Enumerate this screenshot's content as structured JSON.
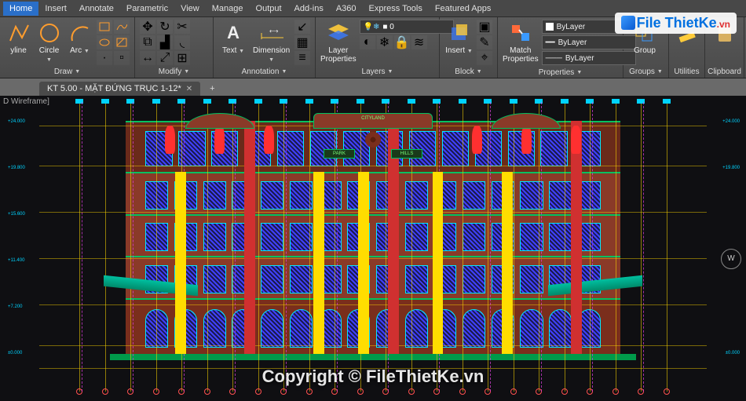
{
  "menu": {
    "items": [
      "Home",
      "Insert",
      "Annotate",
      "Parametric",
      "View",
      "Manage",
      "Output",
      "Add-ins",
      "A360",
      "Express Tools",
      "Featured Apps"
    ],
    "active": 0
  },
  "ribbon": {
    "draw": {
      "title": "Draw",
      "btns": [
        {
          "label": "yline",
          "icon": "polyline"
        },
        {
          "label": "Circle",
          "icon": "circle"
        },
        {
          "label": "Arc",
          "icon": "arc"
        }
      ]
    },
    "modify": {
      "title": "Modify"
    },
    "annotation": {
      "title": "Annotation",
      "btns": [
        {
          "label": "Text",
          "icon": "text"
        },
        {
          "label": "Dimension",
          "icon": "dim"
        }
      ]
    },
    "layers": {
      "title": "Layers",
      "btn": {
        "label": "Layer\nProperties"
      },
      "dd0": "● ● 0"
    },
    "block": {
      "title": "Block",
      "btn": {
        "label": "Insert"
      }
    },
    "properties": {
      "title": "Properties",
      "btn": {
        "label": "Match\nProperties"
      },
      "dd": [
        "ByLayer",
        "ByLayer",
        "ByLayer"
      ]
    },
    "groups": {
      "title": "Groups",
      "btn": {
        "label": "Group"
      }
    },
    "utilities": {
      "title": "Utilities"
    },
    "clipboard": {
      "title": "Clipboard"
    }
  },
  "tabs": {
    "doc": "KT 5.00 - MẶT ĐỨNG TRỤC 1-12*",
    "plus": "+"
  },
  "viewport": {
    "label": "D Wireframe]"
  },
  "building": {
    "sign_top": "CITYLAND",
    "sign_left": "PARK",
    "sign_right": "HILLS"
  },
  "wcs": "W",
  "watermark_logo": {
    "text": "File ThietKe",
    "suffix": ".vn"
  },
  "watermark_center": "Copyright © FileThietKe.vn"
}
